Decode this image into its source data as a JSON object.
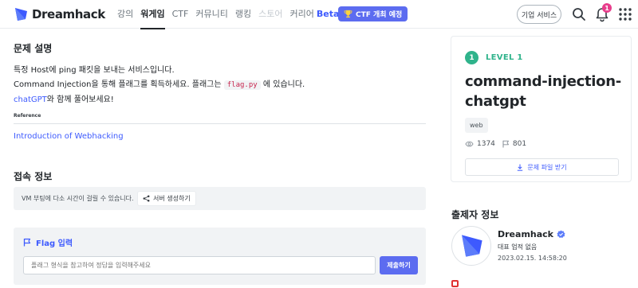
{
  "header": {
    "logo_text": "Dreamhack",
    "nav": [
      {
        "label": "강의"
      },
      {
        "label": "워게임"
      },
      {
        "label": "CTF"
      },
      {
        "label": "커뮤니티"
      },
      {
        "label": "랭킹"
      },
      {
        "label": "스토어"
      },
      {
        "label": "커리어"
      }
    ],
    "beta_label": "Beta",
    "ctf_button": "CTF 개최 예정",
    "business_button": "기업 서비스",
    "notification_count": "1"
  },
  "problem": {
    "section_title": "문제 설명",
    "line1": "특정 Host에 ping 패킷을 보내는 서비스입니다.",
    "line2_pre": "Command Injection을 통해 플래그를 획득하세요. 플래그는",
    "line2_code": "flag.py",
    "line2_post": "에 있습니다.",
    "line3_link": "chatGPT",
    "line3_rest": "와 함께 풀어보세요!",
    "reference_label": "Reference",
    "reference_link": "Introduction of Webhacking"
  },
  "access": {
    "section_title": "접속 정보",
    "vm_notice": "VM 부팅에 다소 시간이 걸릴 수 있습니다.",
    "create_server_button": "서버 생성하기"
  },
  "flag": {
    "title": "Flag 입력",
    "input_placeholder": "플래그 형식을 참고하여 정답을 입력해주세요",
    "submit_button": "제출하기"
  },
  "challenge": {
    "level_number": "1",
    "level_label": "LEVEL 1",
    "title": "command-injection-chatgpt",
    "tag": "web",
    "views": "1374",
    "solves": "801",
    "download_button": "문제 파일 받기"
  },
  "author": {
    "section_title": "출제자 정보",
    "name": "Dreamhack",
    "subtitle": "대표 업적 없음",
    "date": "2023.02.15. 14:58:20"
  },
  "colors": {
    "accent": "#3d5afe",
    "button": "#5c6cf0",
    "level": "#2fb38b",
    "badge": "#e83e8c"
  },
  "icons": [
    "dreamhack-logo-icon",
    "trophy-icon",
    "search-icon",
    "bell-icon",
    "grid-icon",
    "share-icon",
    "flag-icon",
    "eye-icon",
    "solve-flag-icon",
    "download-icon",
    "verified-icon"
  ]
}
